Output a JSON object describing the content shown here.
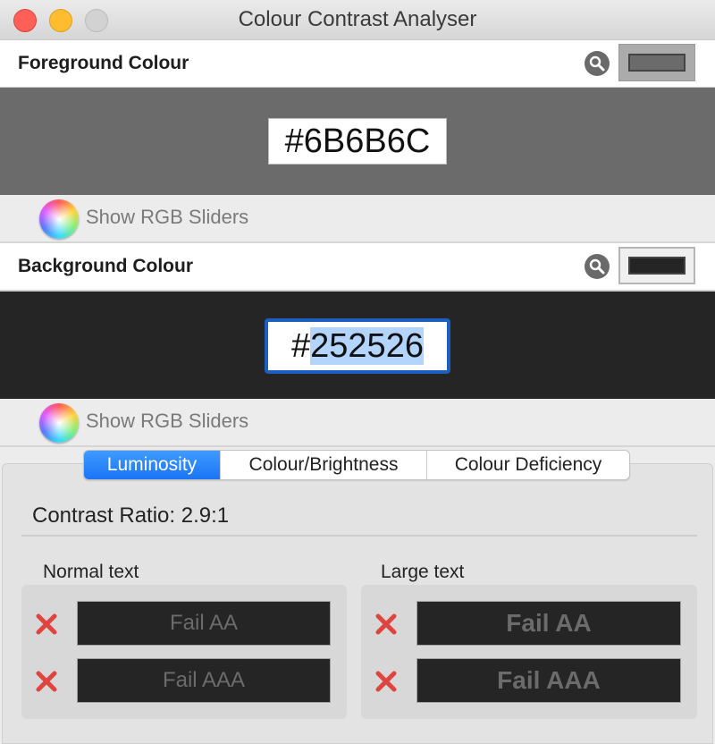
{
  "window": {
    "title": "Colour Contrast Analyser"
  },
  "foreground": {
    "label": "Foreground Colour",
    "hex_prefix": "",
    "hex_value": "#6B6B6C",
    "color": "#6B6B6C",
    "slider_label": "Show RGB Sliders"
  },
  "background": {
    "label": "Background Colour",
    "hex_prefix": "#",
    "hex_value": "252526",
    "color": "#252526",
    "slider_label": "Show RGB Sliders"
  },
  "tabs": [
    {
      "label": "Luminosity",
      "active": true
    },
    {
      "label": "Colour/Brightness",
      "active": false
    },
    {
      "label": "Colour Deficiency",
      "active": false
    }
  ],
  "contrast_ratio": "Contrast Ratio: 2.9:1",
  "normal_text": {
    "label": "Normal text",
    "results": [
      "Fail AA",
      "Fail AAA"
    ]
  },
  "large_text": {
    "label": "Large text",
    "results": [
      "Fail AA",
      "Fail AAA"
    ]
  },
  "icons": {
    "picker": "magnifier-icon",
    "fail": "cross-icon",
    "wheel": "colour-wheel-icon"
  },
  "colors": {
    "accent": "#1A75F5",
    "fail": "#E0443E"
  }
}
